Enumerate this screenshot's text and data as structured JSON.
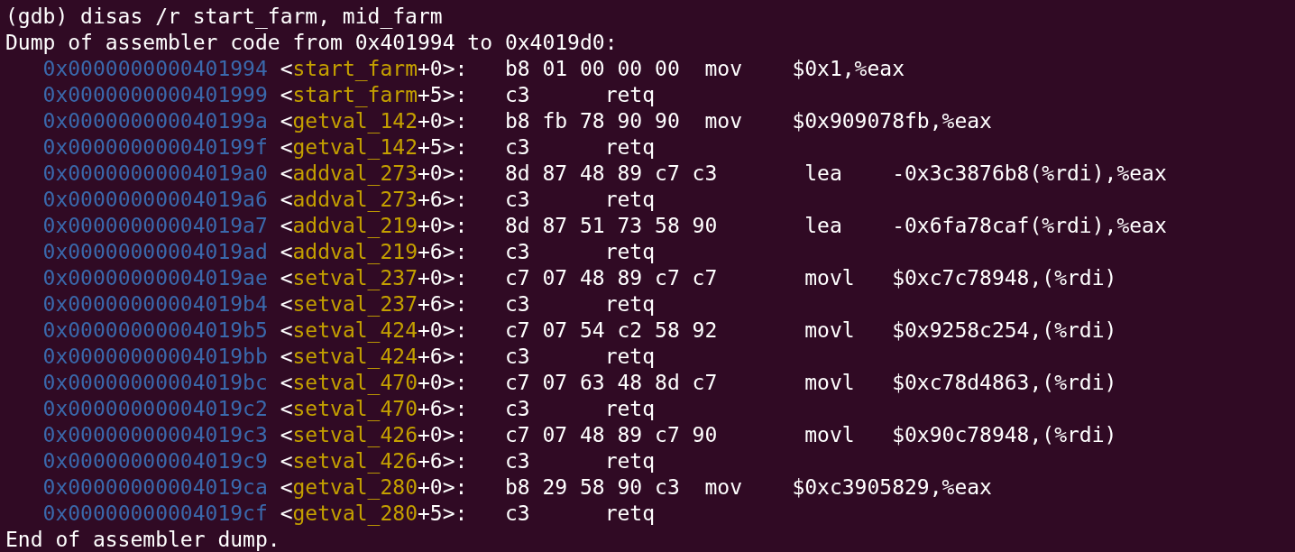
{
  "terminal": {
    "prompt": "(gdb) ",
    "command": "disas /r start_farm, mid_farm",
    "header": "Dump of assembler code from 0x401994 to 0x4019d0:",
    "rows": [
      {
        "address": "0x0000000000401994",
        "open": "<",
        "function": "start_farm",
        "offset": "+0>:",
        "bytes": "b8 01 00 00 00",
        "instruction": "mov    $0x1,%eax"
      },
      {
        "address": "0x0000000000401999",
        "open": "<",
        "function": "start_farm",
        "offset": "+5>:",
        "bytes": "c3",
        "instruction": "retq"
      },
      {
        "address": "0x000000000040199a",
        "open": "<",
        "function": "getval_142",
        "offset": "+0>:",
        "bytes": "b8 fb 78 90 90",
        "instruction": "mov    $0x909078fb,%eax"
      },
      {
        "address": "0x000000000040199f",
        "open": "<",
        "function": "getval_142",
        "offset": "+5>:",
        "bytes": "c3",
        "instruction": "retq"
      },
      {
        "address": "0x00000000004019a0",
        "open": "<",
        "function": "addval_273",
        "offset": "+0>:",
        "bytes": "8d 87 48 89 c7 c3",
        "instruction": "lea    -0x3c3876b8(%rdi),%eax"
      },
      {
        "address": "0x00000000004019a6",
        "open": "<",
        "function": "addval_273",
        "offset": "+6>:",
        "bytes": "c3",
        "instruction": "retq"
      },
      {
        "address": "0x00000000004019a7",
        "open": "<",
        "function": "addval_219",
        "offset": "+0>:",
        "bytes": "8d 87 51 73 58 90",
        "instruction": "lea    -0x6fa78caf(%rdi),%eax"
      },
      {
        "address": "0x00000000004019ad",
        "open": "<",
        "function": "addval_219",
        "offset": "+6>:",
        "bytes": "c3",
        "instruction": "retq"
      },
      {
        "address": "0x00000000004019ae",
        "open": "<",
        "function": "setval_237",
        "offset": "+0>:",
        "bytes": "c7 07 48 89 c7 c7",
        "instruction": "movl   $0xc7c78948,(%rdi)"
      },
      {
        "address": "0x00000000004019b4",
        "open": "<",
        "function": "setval_237",
        "offset": "+6>:",
        "bytes": "c3",
        "instruction": "retq"
      },
      {
        "address": "0x00000000004019b5",
        "open": "<",
        "function": "setval_424",
        "offset": "+0>:",
        "bytes": "c7 07 54 c2 58 92",
        "instruction": "movl   $0x9258c254,(%rdi)"
      },
      {
        "address": "0x00000000004019bb",
        "open": "<",
        "function": "setval_424",
        "offset": "+6>:",
        "bytes": "c3",
        "instruction": "retq"
      },
      {
        "address": "0x00000000004019bc",
        "open": "<",
        "function": "setval_470",
        "offset": "+0>:",
        "bytes": "c7 07 63 48 8d c7",
        "instruction": "movl   $0xc78d4863,(%rdi)"
      },
      {
        "address": "0x00000000004019c2",
        "open": "<",
        "function": "setval_470",
        "offset": "+6>:",
        "bytes": "c3",
        "instruction": "retq"
      },
      {
        "address": "0x00000000004019c3",
        "open": "<",
        "function": "setval_426",
        "offset": "+0>:",
        "bytes": "c7 07 48 89 c7 90",
        "instruction": "movl   $0x90c78948,(%rdi)"
      },
      {
        "address": "0x00000000004019c9",
        "open": "<",
        "function": "setval_426",
        "offset": "+6>:",
        "bytes": "c3",
        "instruction": "retq"
      },
      {
        "address": "0x00000000004019ca",
        "open": "<",
        "function": "getval_280",
        "offset": "+0>:",
        "bytes": "b8 29 58 90 c3",
        "instruction": "mov    $0xc3905829,%eax"
      },
      {
        "address": "0x00000000004019cf",
        "open": "<",
        "function": "getval_280",
        "offset": "+5>:",
        "bytes": "c3",
        "instruction": "retq"
      }
    ],
    "footer": "End of assembler dump."
  }
}
